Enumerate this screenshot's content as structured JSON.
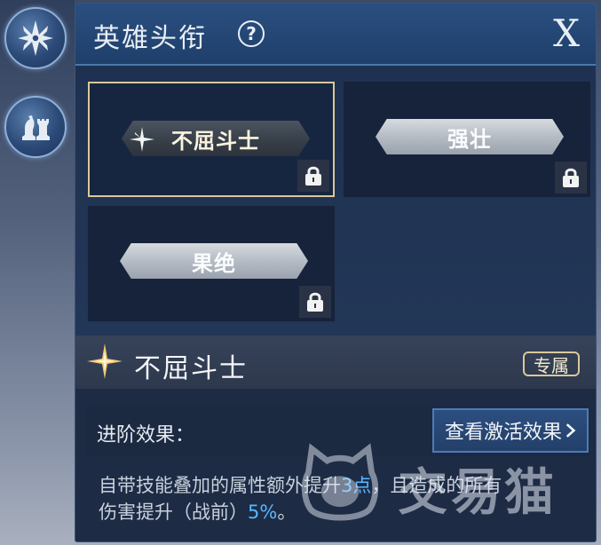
{
  "sidebar": {
    "items": [
      {
        "icon": "emblem-icon"
      },
      {
        "icon": "chess-pieces-icon"
      }
    ]
  },
  "header": {
    "title": "英雄头衔",
    "help_label": "?",
    "close_label": "X"
  },
  "titles": [
    {
      "label": "不屈斗士",
      "selected": true,
      "locked": true
    },
    {
      "label": "强壮",
      "selected": false,
      "locked": true
    },
    {
      "label": "果绝",
      "selected": false,
      "locked": true
    }
  ],
  "detail": {
    "name": "不屈斗士",
    "badge": "专属",
    "effects_label": "进阶效果：",
    "view_button": "查看激活效果",
    "desc_part1": "自带技能叠加的属性额外提升",
    "desc_num1": "3点",
    "desc_part2": "，且造成的所有",
    "desc_part3": "伤害提升（战前）",
    "desc_num2": "5%",
    "desc_part4": "。"
  },
  "watermark": {
    "text": "交易猫"
  },
  "colors": {
    "accent_blue": "#58b8ff",
    "gold_border": "#d9c89a"
  }
}
